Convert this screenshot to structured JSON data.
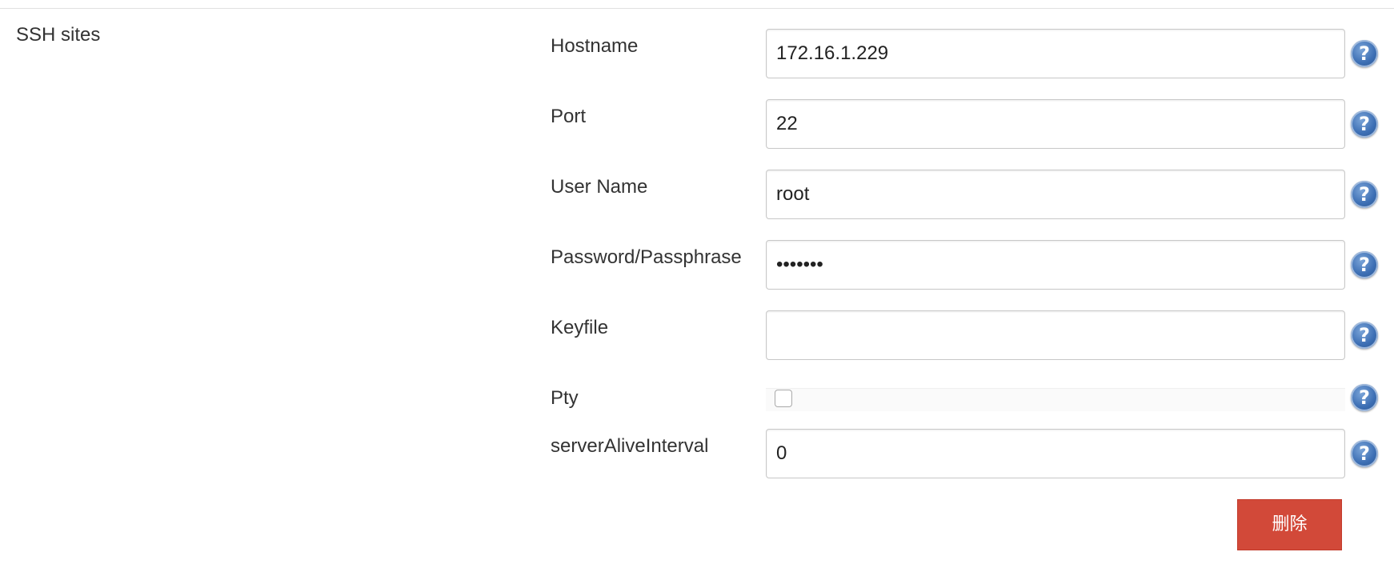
{
  "section": {
    "title": "SSH sites"
  },
  "fields": {
    "hostname": {
      "label": "Hostname",
      "value": "172.16.1.229"
    },
    "port": {
      "label": "Port",
      "value": "22"
    },
    "username": {
      "label": "User Name",
      "value": "root"
    },
    "password": {
      "label": "Password/Passphrase",
      "value": "•••••••"
    },
    "keyfile": {
      "label": "Keyfile",
      "value": ""
    },
    "pty": {
      "label": "Pty",
      "checked": false
    },
    "server_alive_interval": {
      "label": "serverAliveInterval",
      "value": "0"
    }
  },
  "help": {
    "glyph": "?",
    "icon": "help-icon",
    "color": "#3d6fb4"
  },
  "actions": {
    "delete_label": "删除",
    "delete_color": "#d24939"
  }
}
